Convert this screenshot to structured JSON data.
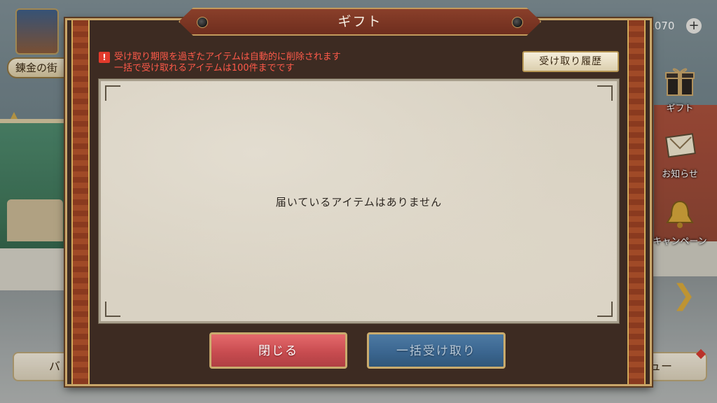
{
  "background": {
    "town_name": "錬金の街",
    "currency_amount": ",070",
    "currency_plus": "+",
    "side_buttons": [
      {
        "label": "ギフト",
        "icon": "gift-box-icon"
      },
      {
        "label": "お知らせ",
        "icon": "letter-icon"
      },
      {
        "label": "キャンペーン",
        "icon": "bell-icon"
      }
    ],
    "bottom_left_label": "バ",
    "bottom_right_label": "ュー"
  },
  "dialog": {
    "title": "ギフト",
    "notice_lines": [
      "受け取り期限を過ぎたアイテムは自動的に削除されます",
      "一括で受け取れるアイテムは100件までです"
    ],
    "history_button_label": "受け取り履歴",
    "empty_message": "届いているアイテムはありません",
    "close_button_label": "閉じる",
    "claim_all_button_label": "一括受け取り"
  },
  "colors": {
    "notice_red": "#ff5a4a",
    "close_button": "#c84c50",
    "claim_all_button": "#3b6690",
    "frame_gold": "#c9a66a"
  }
}
